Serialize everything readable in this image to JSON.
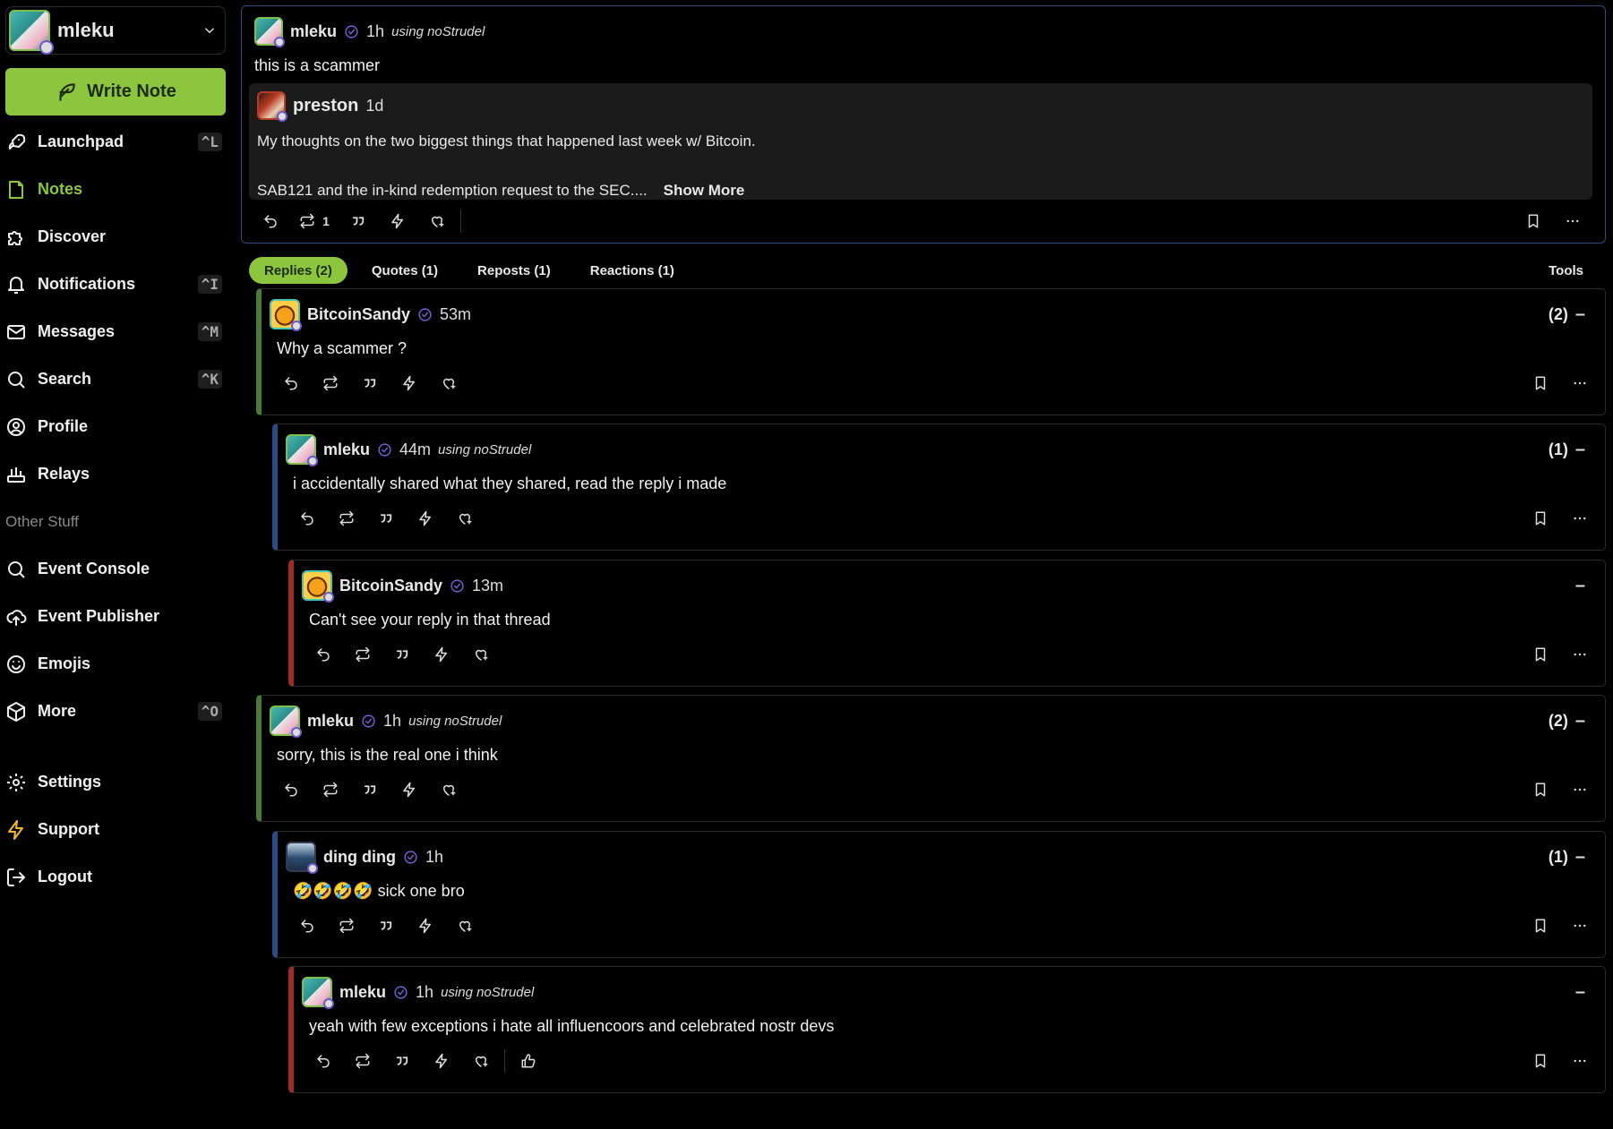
{
  "sidebar": {
    "account_name": "mleku",
    "write_label": "Write Note",
    "items": [
      {
        "label": "Launchpad",
        "key": "^L"
      },
      {
        "label": "Notes",
        "key": ""
      },
      {
        "label": "Discover",
        "key": ""
      },
      {
        "label": "Notifications",
        "key": "^I"
      },
      {
        "label": "Messages",
        "key": "^M"
      },
      {
        "label": "Search",
        "key": "^K"
      },
      {
        "label": "Profile",
        "key": ""
      },
      {
        "label": "Relays",
        "key": ""
      }
    ],
    "other_label": "Other Stuff",
    "other_items": [
      {
        "label": "Event Console"
      },
      {
        "label": "Event Publisher"
      },
      {
        "label": "Emojis"
      },
      {
        "label": "More",
        "key": "^O"
      }
    ],
    "bottom_items": [
      {
        "label": "Settings"
      },
      {
        "label": "Support"
      },
      {
        "label": "Logout"
      }
    ]
  },
  "root": {
    "author": "mleku",
    "time": "1h",
    "client": "using noStrudel",
    "text": "this is a scammer",
    "embed": {
      "author": "preston",
      "time": "1d",
      "line1": "My thoughts on the two biggest things that happened last week w/ Bitcoin.",
      "line2": "SAB121 and the in-kind redemption request to the SEC....",
      "show_more": "Show More"
    },
    "repost_count": "1"
  },
  "tabs": {
    "replies": "Replies (2)",
    "quotes": "Quotes (1)",
    "reposts": "Reposts (1)",
    "reactions": "Reactions (1)",
    "tools": "Tools"
  },
  "replies": [
    {
      "author": "BitcoinSandy",
      "time": "53m",
      "client": "",
      "text": "Why a scammer ?",
      "count": "(2)"
    },
    {
      "author": "mleku",
      "time": "44m",
      "client": "using noStrudel",
      "text": "i accidentally shared what they shared, read the reply i made",
      "count": "(1)"
    },
    {
      "author": "BitcoinSandy",
      "time": "13m",
      "client": "",
      "text": "Can't see your reply in that thread",
      "count": ""
    },
    {
      "author": "mleku",
      "time": "1h",
      "client": "using noStrudel",
      "text": "sorry, this is the real one i think",
      "count": "(2)"
    },
    {
      "author": "ding ding",
      "time": "1h",
      "client": "",
      "text": "🤣🤣🤣🤣 sick one bro",
      "count": "(1)"
    },
    {
      "author": "mleku",
      "time": "1h",
      "client": "using noStrudel",
      "text": "yeah with few exceptions i hate all influencoors and celebrated nostr devs",
      "count": ""
    }
  ],
  "colors": {
    "accent": "#8cc63f",
    "verified": "#7b5cd6",
    "border_blue": "#2e4a82",
    "thread_green": "#4a7a38",
    "thread_red": "#9b2c2c"
  }
}
